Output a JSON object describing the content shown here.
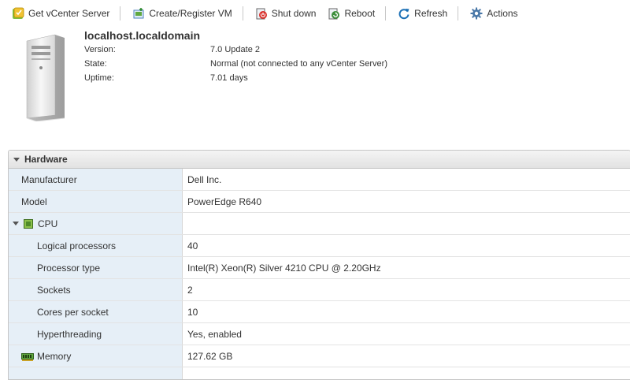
{
  "toolbar": {
    "items": [
      {
        "label": "Get vCenter Server",
        "icon": "vcenter-icon"
      },
      {
        "label": "Create/Register VM",
        "icon": "create-vm-icon"
      },
      {
        "label": "Shut down",
        "icon": "shutdown-icon"
      },
      {
        "label": "Reboot",
        "icon": "reboot-icon"
      },
      {
        "label": "Refresh",
        "icon": "refresh-icon"
      },
      {
        "label": "Actions",
        "icon": "gear-icon"
      }
    ]
  },
  "host": {
    "name": "localhost.localdomain",
    "fields": [
      {
        "key": "Version:",
        "value": "7.0 Update 2"
      },
      {
        "key": "State:",
        "value": "Normal (not connected to any vCenter Server)"
      },
      {
        "key": "Uptime:",
        "value": "7.01 days"
      }
    ]
  },
  "hardware": {
    "title": "Hardware",
    "manufacturer": {
      "label": "Manufacturer",
      "value": "Dell Inc."
    },
    "model": {
      "label": "Model",
      "value": "PowerEdge R640"
    },
    "cpu": {
      "label": "CPU",
      "rows": [
        {
          "label": "Logical processors",
          "value": "40"
        },
        {
          "label": "Processor type",
          "value": "Intel(R) Xeon(R) Silver 4210 CPU @ 2.20GHz"
        },
        {
          "label": "Sockets",
          "value": "2"
        },
        {
          "label": "Cores per socket",
          "value": "10"
        },
        {
          "label": "Hyperthreading",
          "value": "Yes, enabled"
        }
      ]
    },
    "memory": {
      "label": "Memory",
      "value": "127.62 GB"
    }
  },
  "colors": {
    "label_bg": "#e6eff7",
    "accent": "#1a6fb5"
  }
}
